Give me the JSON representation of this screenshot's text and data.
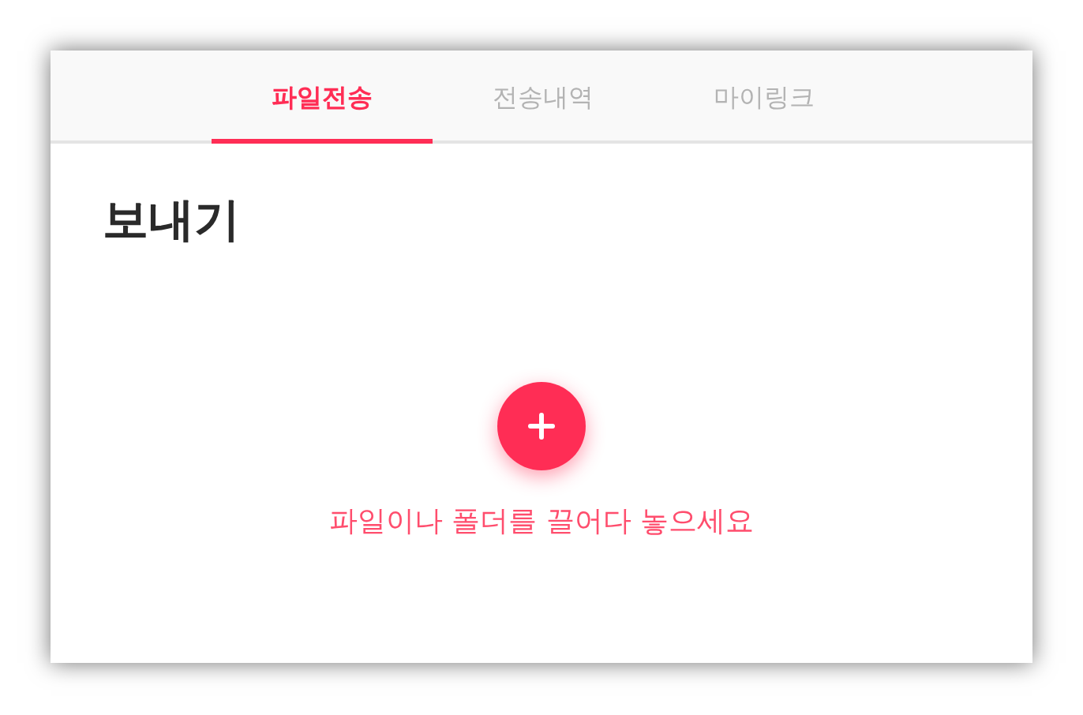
{
  "tabs": [
    {
      "label": "파일전송",
      "selected": true
    },
    {
      "label": "전송내역",
      "selected": false
    },
    {
      "label": "마이링크",
      "selected": false
    }
  ],
  "heading": "보내기",
  "dropzone": {
    "hint": "파일이나 폴더를 끌어다 놓으세요"
  }
}
